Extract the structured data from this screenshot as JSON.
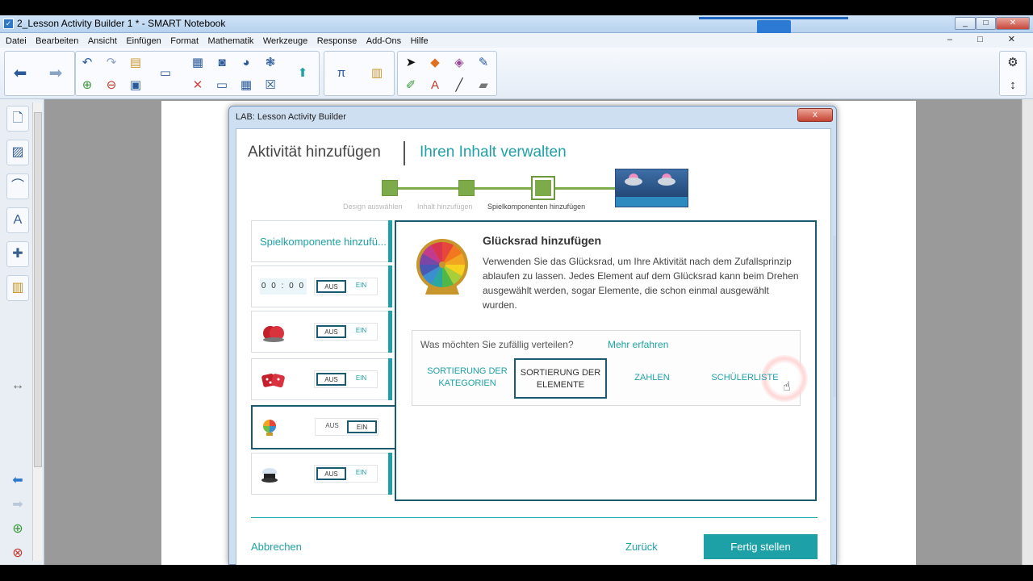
{
  "window": {
    "title": "2_Lesson Activity Builder 1 * - SMART Notebook",
    "min_label": "_",
    "max_label": "□",
    "close_label": "✕"
  },
  "menu": {
    "items": [
      "Datei",
      "Bearbeiten",
      "Ansicht",
      "Einfügen",
      "Format",
      "Mathematik",
      "Werkzeuge",
      "Response",
      "Add-Ons",
      "Hilfe"
    ],
    "right": "– □ ✕"
  },
  "dialog": {
    "title": "LAB: Lesson Activity Builder",
    "close_label": "x",
    "tab_add": "Aktivität hinzufügen",
    "tab_manage": "Ihren Inhalt verwalten",
    "steps": [
      "Design auswählen",
      "Inhalt hinzufügen",
      "Spielkomponenten hinzufügen"
    ],
    "components": {
      "header_label": "Spielkomponente hinzufü...",
      "timer_digits": "0 0 : 0 0",
      "off_label": "AUS",
      "on_label": "EIN"
    },
    "panel": {
      "title": "Glücksrad hinzufügen",
      "description": "Verwenden Sie das Glücksrad, um Ihre Aktivität nach dem Zufallsprinzip ablaufen zu lassen. Jedes Element auf dem Glücksrad kann beim Drehen ausgewählt werden, sogar Elemente, die schon einmal ausgewählt wurden.",
      "question": "Was möchten Sie zufällig verteilen?",
      "learn_more": "Mehr erfahren",
      "options": [
        "SORTIERUNG DER KATEGORIEN",
        "SORTIERUNG DER ELEMENTE",
        "ZAHLEN",
        "SCHÜLERLISTE"
      ]
    },
    "footer": {
      "cancel": "Abbrechen",
      "back": "Zurück",
      "finish": "Fertig stellen"
    }
  },
  "colors": {
    "accent": "#1ea1a6",
    "step_green": "#7eab4a",
    "dark_teal": "#1b5b72"
  }
}
